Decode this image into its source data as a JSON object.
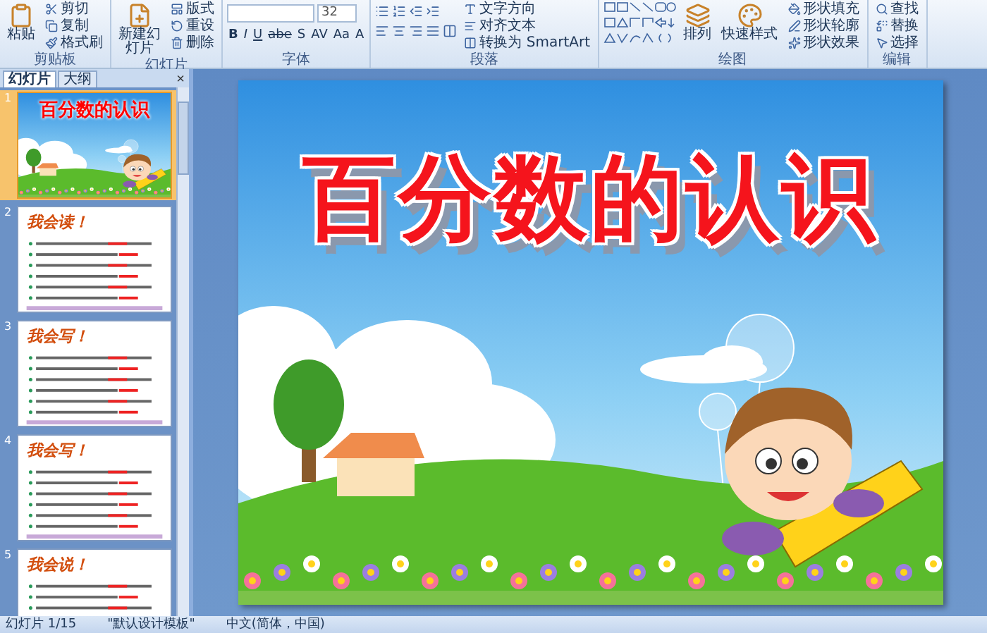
{
  "ribbon": {
    "groups": [
      {
        "kind": "clipboard",
        "label": "剪贴板",
        "large": [
          "粘贴"
        ],
        "small": [
          "剪切",
          "复制",
          "格式刷"
        ]
      },
      {
        "kind": "slides",
        "label": "幻灯片",
        "large": [
          "新建幻灯片"
        ],
        "small": [
          "版式",
          "重设",
          "删除"
        ]
      },
      {
        "kind": "font",
        "label": "字体",
        "font_size": "32",
        "format_buttons": [
          "B",
          "I",
          "U",
          "abe",
          "S",
          "AV",
          "Aa",
          "A"
        ]
      },
      {
        "kind": "paragraph",
        "label": "段落",
        "small": [
          "文字方向",
          "对齐文本",
          "转换为 SmartArt"
        ]
      },
      {
        "kind": "drawing",
        "label": "绘图",
        "large": [
          "排列",
          "快速样式"
        ],
        "small": [
          "形状填充",
          "形状轮廓",
          "形状效果"
        ]
      },
      {
        "kind": "editing",
        "label": "编辑",
        "small": [
          "查找",
          "替换",
          "选择"
        ]
      }
    ]
  },
  "pane": {
    "tabs": [
      {
        "label": "幻灯片",
        "selected": true
      },
      {
        "label": "大纲",
        "selected": false
      }
    ],
    "close": "×"
  },
  "thumbnails": [
    {
      "number": "1",
      "kind": "title",
      "title": "百分数的认识",
      "selected": true
    },
    {
      "number": "2",
      "kind": "content",
      "title": "我会读！",
      "selected": false
    },
    {
      "number": "3",
      "kind": "content",
      "title": "我会写！",
      "selected": false
    },
    {
      "number": "4",
      "kind": "content",
      "title": "我会写！",
      "selected": false
    },
    {
      "number": "5",
      "kind": "content",
      "title": "我会说！",
      "selected": false
    }
  ],
  "slide": {
    "title": "百分数的认识"
  },
  "status_bar": {
    "slide": "幻灯片 1/15",
    "theme": "\"默认设计模板\"",
    "language": "中文(简体，中国)"
  }
}
